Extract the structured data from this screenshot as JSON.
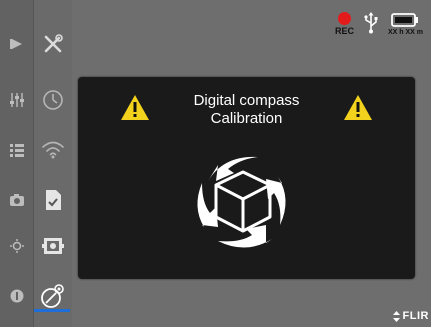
{
  "status_bar": {
    "rec_label": "REC",
    "battery_label": "XX h XX m",
    "rec_color": "#e41b1b"
  },
  "sidebar": {
    "rail1_icons": [
      "play-mode-icon",
      "sliders-icon",
      "list-icon",
      "camera-icon",
      "brightness-icon",
      "info-icon"
    ],
    "rail2_icons": [
      "tools-icon",
      "timer-icon",
      "wifi-icon",
      "document-check-icon",
      "image-adjust-icon",
      "compass-settings-icon"
    ],
    "selected": "compass-settings-icon",
    "selection_color": "#1e6ed8"
  },
  "dialog": {
    "title_line1": "Digital compass",
    "title_line2": "Calibration",
    "warning_color": "#f2d21c"
  },
  "brand": {
    "text": "FLIR"
  }
}
